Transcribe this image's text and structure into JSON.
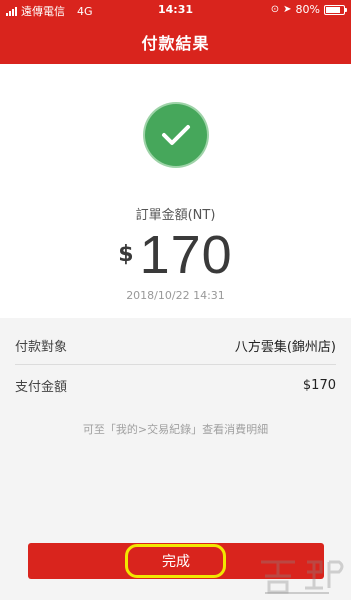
{
  "status_bar": {
    "carrier": "遠傳電信",
    "network": "4G",
    "time": "14:31",
    "battery_percent": "80%",
    "battery_level": 0.8
  },
  "nav": {
    "title": "付款結果"
  },
  "result": {
    "status_icon": "check-icon",
    "amount_label": "訂單金額(NT)",
    "currency_symbol": "$",
    "amount": "170",
    "datetime": "2018/10/22 14:31"
  },
  "details": {
    "rows": [
      {
        "label": "付款對象",
        "value": "八方雲集(錦州店)"
      },
      {
        "label": "支付金額",
        "value": "$170"
      }
    ],
    "hint": "可至「我的>交易紀錄」查看消費明細"
  },
  "actions": {
    "done_label": "完成"
  },
  "colors": {
    "brand_red": "#d9241d",
    "success_green": "#46a75b",
    "highlight_yellow": "#f2e600"
  }
}
